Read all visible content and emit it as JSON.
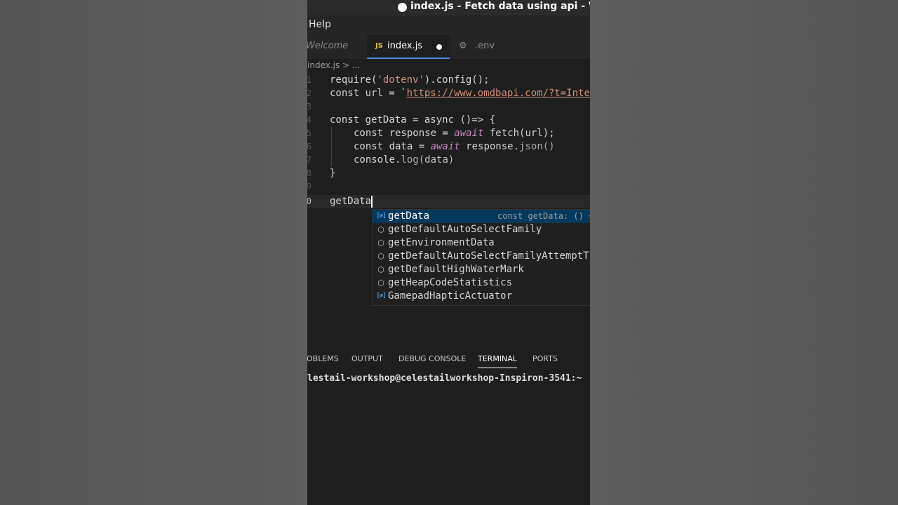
{
  "window": {
    "title": "index.js - Fetch data using api - Visua"
  },
  "menu": {
    "help": "Help"
  },
  "tabs": {
    "welcome": "Welcome",
    "index_icon": "JS",
    "index": "index.js",
    "env": ".env"
  },
  "breadcrumb": "index.js > ...",
  "code": {
    "line_numbers": [
      "1",
      "2",
      "3",
      "4",
      "5",
      "6",
      "7",
      "8",
      "9",
      "0"
    ],
    "l1": {
      "a": "require(",
      "b": "'dotenv'",
      "c": ").config();"
    },
    "l2": {
      "a": "const url = `",
      "b": "https://www.omdbapi.com/?t=Inte"
    },
    "l4": {
      "a": "const ",
      "b": "getData",
      "c": " = async ()=> {"
    },
    "l5": {
      "a": "const response = ",
      "b": "await",
      "c": " fetch(url);"
    },
    "l6": {
      "a": "const data = ",
      "b": "await",
      "c": " response.",
      "d": "json()"
    },
    "l7": {
      "a": "console.",
      "b": "log",
      "c": "(data)"
    },
    "l8": "}",
    "l10": "getData"
  },
  "suggestions": [
    {
      "icon": "variable-icon",
      "label": "getData",
      "detail": "const getData: () ="
    },
    {
      "icon": "method-icon",
      "label": "getDefaultAutoSelectFamily",
      "detail": ""
    },
    {
      "icon": "method-icon",
      "label": "getEnvironmentData",
      "detail": ""
    },
    {
      "icon": "method-icon",
      "label": "getDefaultAutoSelectFamilyAttemptT",
      "detail": ""
    },
    {
      "icon": "method-icon",
      "label": "getDefaultHighWaterMark",
      "detail": ""
    },
    {
      "icon": "method-icon",
      "label": "getHeapCodeStatistics",
      "detail": ""
    },
    {
      "icon": "variable-icon",
      "label": "GamepadHapticActuator",
      "detail": ""
    }
  ],
  "panel": {
    "problems": "OBLEMS",
    "output": "OUTPUT",
    "debug": "DEBUG CONSOLE",
    "terminal": "TERMINAL",
    "ports": "PORTS"
  },
  "terminal": {
    "prompt": "lestail-workshop@celestailworkshop-Inspiron-3541:~"
  }
}
